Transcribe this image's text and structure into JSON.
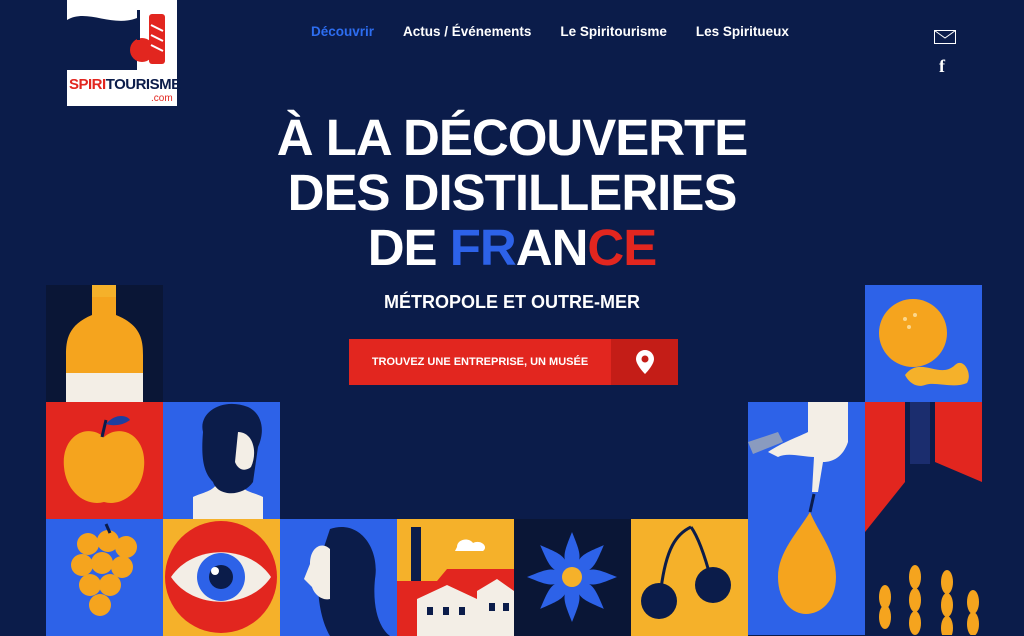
{
  "logo": {
    "text_red": "SPIRI",
    "text_dark": "TOURISME",
    "suffix": ".com"
  },
  "nav": {
    "items": [
      {
        "label": "Découvrir"
      },
      {
        "label": "Actus / Événements"
      },
      {
        "label": "Le Spiritourisme"
      },
      {
        "label": "Les Spiritueux"
      }
    ]
  },
  "social": {
    "mail_icon": "mail-icon",
    "facebook_icon": "facebook-icon",
    "facebook_glyph": "f"
  },
  "hero": {
    "line1": "À LA DÉCOUVERTE",
    "line2": "DES DISTILLERIES",
    "line3_prefix": "DE ",
    "line3_blue": "FR",
    "line3_white": "AN",
    "line3_red": "CE",
    "subtitle": "MÉTROPOLE ET OUTRE-MER"
  },
  "cta": {
    "label": "TROUVEZ UNE ENTREPRISE, UN MUSÉE",
    "icon": "map-pin-icon"
  },
  "colors": {
    "background": "#0b1c4a",
    "accent_blue": "#2d62e8",
    "accent_red": "#e2261f",
    "accent_yellow": "#f5b12a"
  }
}
